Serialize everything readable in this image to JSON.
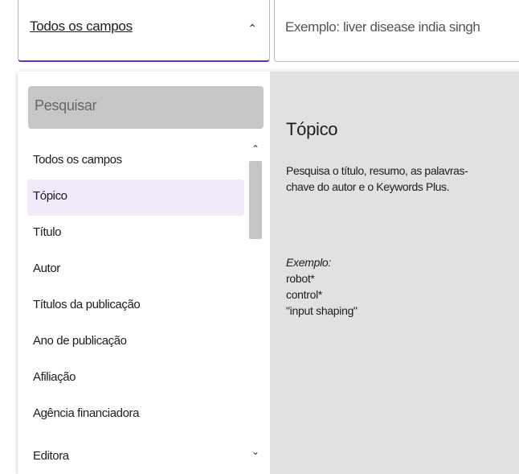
{
  "field_select": {
    "label": "Todos os campos",
    "icon": "chevron-up-icon"
  },
  "search": {
    "placeholder": "Exemplo: liver disease india singh"
  },
  "dropdown": {
    "filter_placeholder": "Pesquisar",
    "options": [
      {
        "label": "Todos os campos",
        "selected": false
      },
      {
        "label": "Tópico",
        "selected": true
      },
      {
        "label": "Título",
        "selected": false
      },
      {
        "label": "Autor",
        "selected": false
      },
      {
        "label": "Títulos da publicação",
        "selected": false
      },
      {
        "label": "Ano de publicação",
        "selected": false
      },
      {
        "label": "Afiliação",
        "selected": false
      },
      {
        "label": "Agência financiadora",
        "selected": false
      },
      {
        "label": "Editora",
        "selected": false
      }
    ],
    "scroll_up_icon": "chevron-up-icon",
    "scroll_down_icon": "chevron-down-icon"
  },
  "detail": {
    "title": "Tópico",
    "description": "Pesquisa o título, resumo, as palavras-chave do autor e o Keywords Plus.",
    "example_label": "Exemplo:",
    "examples": [
      "robot*",
      "control*",
      "\"input shaping\""
    ]
  },
  "colors": {
    "accent": "#5e33bf",
    "selected_bg": "#efe9f9",
    "detail_bg": "#e1e1e1",
    "filter_bg": "#c7c7c7"
  }
}
